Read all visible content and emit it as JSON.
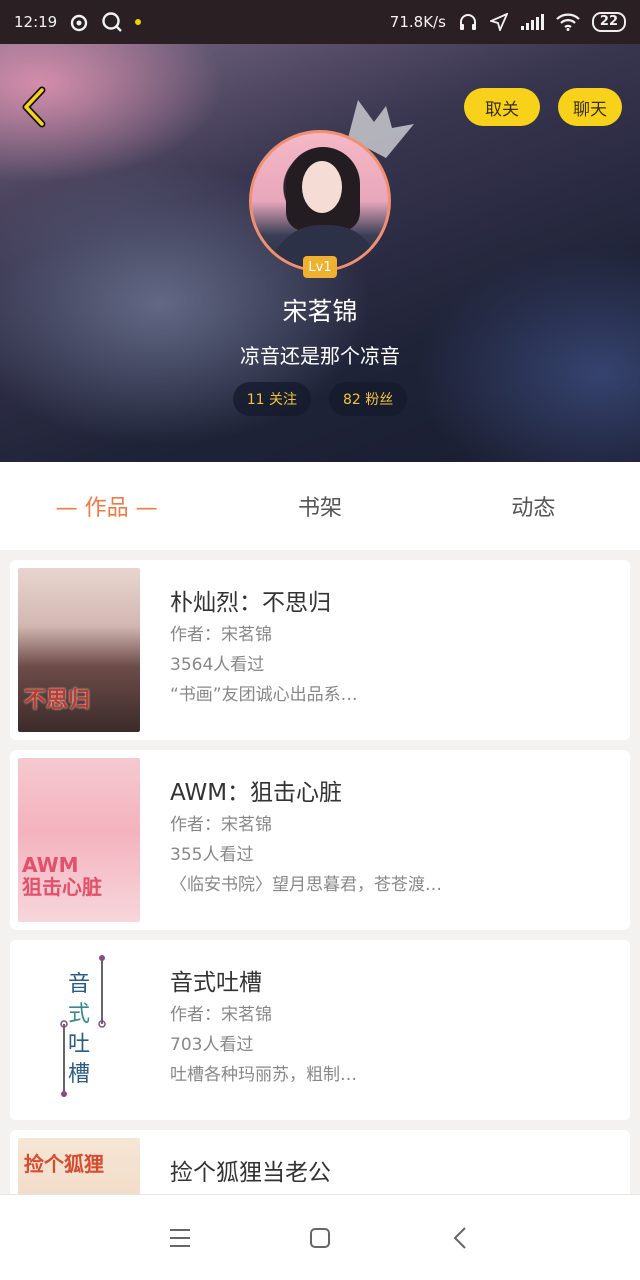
{
  "status_bar": {
    "time": "12:19",
    "speed": "71.8K/s",
    "battery": "22"
  },
  "profile": {
    "unfollow_label": "取关",
    "chat_label": "聊天",
    "level": "Lv1",
    "name": "宋茗锦",
    "signature": "凉音还是那个凉音",
    "following": "11 关注",
    "fans": "82 粉丝"
  },
  "tabs": [
    {
      "label": "— 作品 —",
      "active": true
    },
    {
      "label": "书架",
      "active": false
    },
    {
      "label": "动态",
      "active": false
    }
  ],
  "works": [
    {
      "title": "朴灿烈：不思归",
      "author": "作者：宋茗锦",
      "views": "3564人看过",
      "desc": "“书画”友团诚心出品系…",
      "cover_text": "不思归"
    },
    {
      "title": "AWM：狙击心脏",
      "author": "作者：宋茗锦",
      "views": "355人看过",
      "desc": "〈临安书院〉望月思暮君，苍苍渡…",
      "cover_text_1": "AWM",
      "cover_text_2": "狙击心脏"
    },
    {
      "title": "音式吐槽",
      "author": "作者：宋茗锦",
      "views": "703人看过",
      "desc": "吐槽各种玛丽苏，粗制…",
      "cover_chars": [
        "音",
        "式",
        "吐",
        "槽"
      ]
    },
    {
      "title": "捡个狐狸当老公",
      "cover_text": "捡个狐狸"
    }
  ],
  "colors": {
    "accent_orange": "#f07a45",
    "pill_yellow": "#f8d21a",
    "stat_text": "#f0c43a"
  }
}
